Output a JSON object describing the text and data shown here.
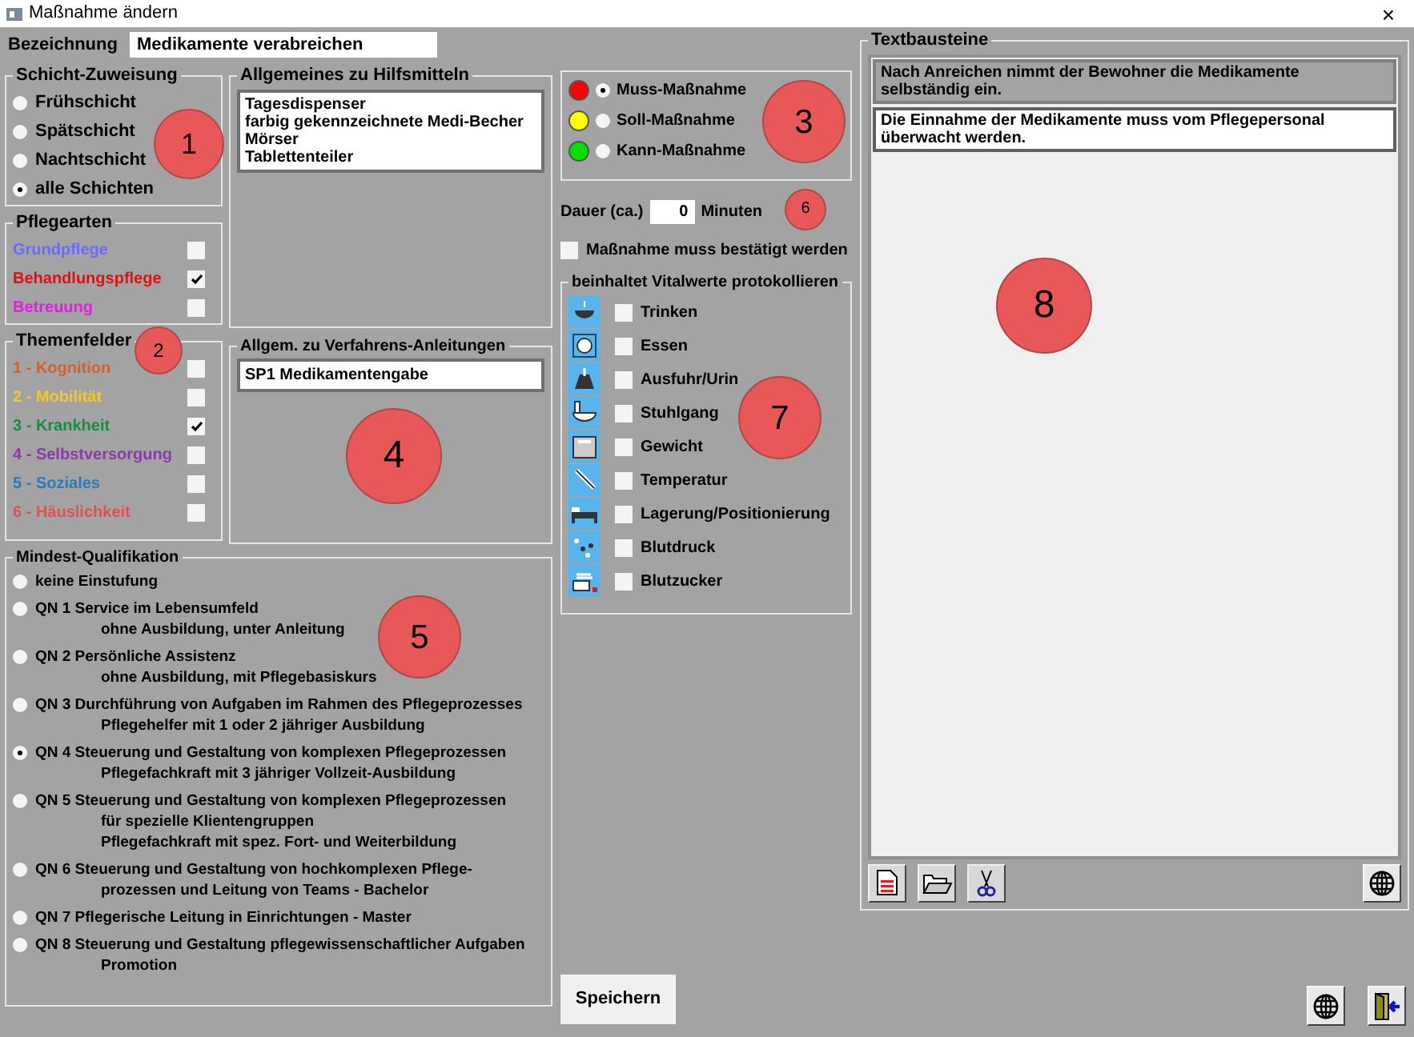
{
  "window": {
    "title": "Maßnahme ändern",
    "close": "×"
  },
  "bezeichnung": {
    "label": "Bezeichnung",
    "value": "Medikamente verabreichen"
  },
  "schicht": {
    "title": "Schicht-Zuweisung",
    "options": [
      {
        "label": "Frühschicht",
        "selected": false
      },
      {
        "label": "Spätschicht",
        "selected": false
      },
      {
        "label": "Nachtschicht",
        "selected": false
      },
      {
        "label": "alle Schichten",
        "selected": true
      }
    ]
  },
  "pflegearten": {
    "title": "Pflegearten",
    "items": [
      {
        "label": "Grundpflege",
        "color": "#6a6aff",
        "checked": false
      },
      {
        "label": "Behandlungspflege",
        "color": "#e01010",
        "checked": true
      },
      {
        "label": "Betreuung",
        "color": "#e020e0",
        "checked": false
      }
    ]
  },
  "themenfelder": {
    "title": "Themenfelder",
    "items": [
      {
        "label": "1 - Kognition",
        "color": "#d4602a",
        "checked": false
      },
      {
        "label": "2 - Mobilität",
        "color": "#f0c830",
        "checked": false
      },
      {
        "label": "3 - Krankheit",
        "color": "#1c8a48",
        "checked": true
      },
      {
        "label": "4 - Selbstversorgung",
        "color": "#8a3aa8",
        "checked": false
      },
      {
        "label": "5 - Soziales",
        "color": "#2a7cb8",
        "checked": false
      },
      {
        "label": "6 - Häuslichkeit",
        "color": "#e05050",
        "checked": false
      }
    ]
  },
  "hilfsmittel": {
    "title": "Allgemeines zu Hilfsmitteln",
    "lines": [
      "Tagesdispenser",
      "farbig gekennzeichnete Medi-Becher",
      "Mörser",
      "Tablettenteiler"
    ]
  },
  "verfahren": {
    "title": "Allgem. zu Verfahrens-Anleitungen",
    "lines": [
      "SP1 Medikamentengabe"
    ]
  },
  "priority": {
    "options": [
      {
        "label": "Muss-Maßnahme",
        "color": "#ff0000",
        "selected": true
      },
      {
        "label": "Soll-Maßnahme",
        "color": "#ffff00",
        "selected": false
      },
      {
        "label": "Kann-Maßnahme",
        "color": "#00e000",
        "selected": false
      }
    ]
  },
  "dauer": {
    "label": "Dauer (ca.)",
    "value": "0",
    "unit": "Minuten"
  },
  "bestaetigung": {
    "label": "Maßnahme muss bestätigt werden",
    "checked": false
  },
  "vitalwerte": {
    "title": "beinhaltet Vitalwerte protokollieren",
    "items": [
      {
        "label": "Trinken",
        "checked": false
      },
      {
        "label": "Essen",
        "checked": false
      },
      {
        "label": "Ausfuhr/Urin",
        "checked": false
      },
      {
        "label": "Stuhlgang",
        "checked": false
      },
      {
        "label": "Gewicht",
        "checked": false
      },
      {
        "label": "Temperatur",
        "checked": false
      },
      {
        "label": "Lagerung/Positionierung",
        "checked": false
      },
      {
        "label": "Blutdruck",
        "checked": false
      },
      {
        "label": "Blutzucker",
        "checked": false
      }
    ]
  },
  "qualifikation": {
    "title": "Mindest-Qualifikation",
    "options": [
      {
        "lines": [
          "keine Einstufung"
        ],
        "selected": false
      },
      {
        "lines": [
          "QN 1 Service im Lebensumfeld",
          "ohne Ausbildung, unter Anleitung"
        ],
        "selected": false
      },
      {
        "lines": [
          "QN 2 Persönliche Assistenz",
          "ohne Ausbildung, mit Pflegebasiskurs"
        ],
        "selected": false
      },
      {
        "lines": [
          "QN 3 Durchführung von Aufgaben im Rahmen des Pflegeprozesses",
          "Pflegehelfer mit 1 oder 2 jähriger Ausbildung"
        ],
        "selected": false
      },
      {
        "lines": [
          "QN 4 Steuerung und Gestaltung von komplexen Pflegeprozessen",
          "Pflegefachkraft mit 3 jähriger Vollzeit-Ausbildung"
        ],
        "selected": true
      },
      {
        "lines": [
          "QN 5 Steuerung und Gestaltung von komplexen Pflegeprozessen",
          "für spezielle Klientengruppen",
          "Pflegefachkraft mit spez. Fort- und Weiterbildung"
        ],
        "selected": false
      },
      {
        "lines": [
          "QN 6 Steuerung und Gestaltung von hochkomplexen Pflege-",
          "prozessen und Leitung von Teams - Bachelor"
        ],
        "selected": false
      },
      {
        "lines": [
          "QN 7 Pflegerische Leitung in Einrichtungen - Master"
        ],
        "selected": false
      },
      {
        "lines": [
          "QN 8 Steuerung und Gestaltung pflegewissenschaftlicher Aufgaben",
          "Promotion"
        ],
        "selected": false
      }
    ]
  },
  "textbausteine": {
    "title": "Textbausteine",
    "items": [
      {
        "text": "Nach Anreichen nimmt der Bewohner die Medikamente selbständig ein.",
        "selected": true
      },
      {
        "text": "Die Einnahme der Medikamente muss vom Pflegepersonal überwacht werden.",
        "selected": false
      }
    ]
  },
  "save": "Speichern",
  "markers": [
    "1",
    "2",
    "3",
    "4",
    "5",
    "6",
    "7",
    "8"
  ]
}
